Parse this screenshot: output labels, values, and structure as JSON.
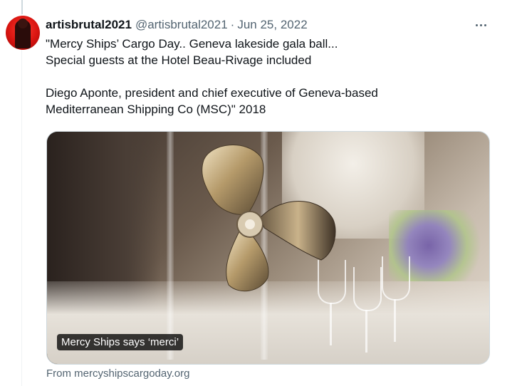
{
  "tweet": {
    "display_name": "artisbrutal2021",
    "handle": "@artisbrutal2021",
    "separator": "·",
    "date": "Jun 25, 2022",
    "text_lines": [
      "\"Mercy Ships’ Cargo Day.. Geneva lakeside gala ball...",
      "Special guests at the Hotel Beau-Rivage included",
      "",
      "Diego Aponte, president and chief executive of Geneva-based",
      "Mediterranean Shipping Co (MSC)\" 2018"
    ],
    "media": {
      "caption": "Mercy Ships says ‘merci’",
      "source": "From mercyshipscargoday.org"
    },
    "icons": {
      "more": "more-horizontal-icon",
      "avatar": "user-avatar"
    },
    "colors": {
      "text": "#0f1419",
      "secondary_text": "#536471",
      "border": "#cfd9de",
      "avatar_red": "#d81410"
    }
  }
}
